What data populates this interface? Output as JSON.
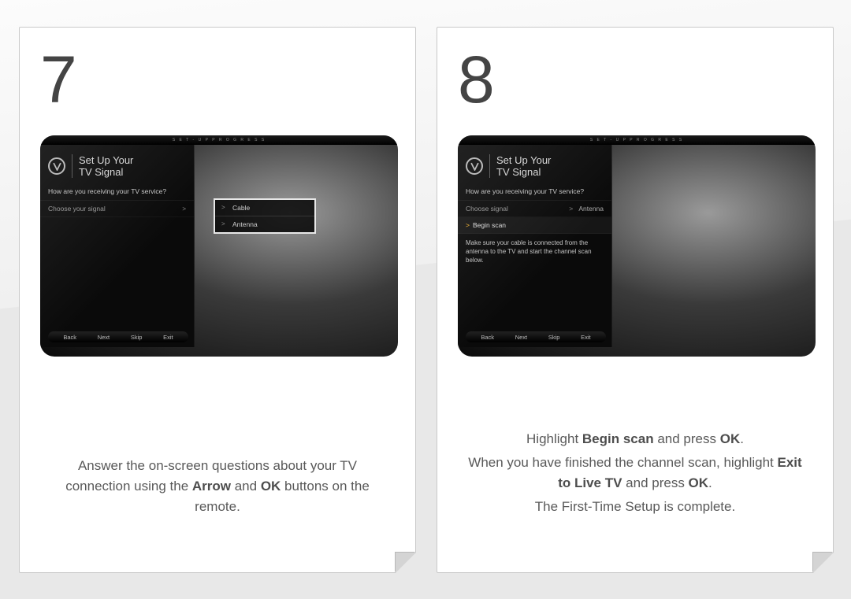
{
  "step7": {
    "number": "7",
    "tv": {
      "top_bar_label": "S E T - U P   P R O G R E S S",
      "title_line1": "Set Up Your",
      "title_line2": "TV Signal",
      "question": "How are you receiving your TV service?",
      "choose_label": "Choose your signal",
      "dropdown": {
        "opt1": "Cable",
        "opt2": "Antenna"
      },
      "nav": {
        "back": "Back",
        "next": "Next",
        "skip": "Skip",
        "exit": "Exit"
      }
    },
    "instruction": {
      "pre1": "Answer the on-screen questions about your TV connection using the ",
      "bold1": "Arrow",
      "mid1": " and ",
      "bold2": "OK",
      "post1": " buttons on the remote."
    }
  },
  "step8": {
    "number": "8",
    "tv": {
      "top_bar_label": "S E T - U P   P R O G R E S S",
      "title_line1": "Set Up Your",
      "title_line2": "TV Signal",
      "question": "How are you receiving your TV service?",
      "choose_label": "Choose signal",
      "choose_value": "Antenna",
      "begin_label": "Begin scan",
      "help_text": "Make sure your cable is connected from the antenna to the TV and start the channel scan below.",
      "nav": {
        "back": "Back",
        "next": "Next",
        "skip": "Skip",
        "exit": "Exit"
      }
    },
    "instruction": {
      "line1_pre": "Highlight ",
      "line1_bold": "Begin scan",
      "line1_mid": " and press ",
      "line1_bold2": "OK",
      "line1_post": ".",
      "line2_pre": "When you have finished the channel scan, highlight ",
      "line2_bold": "Exit to Live TV",
      "line2_mid": " and press ",
      "line2_bold2": "OK",
      "line2_post": ".",
      "line3": "The First-Time Setup is complete."
    }
  }
}
